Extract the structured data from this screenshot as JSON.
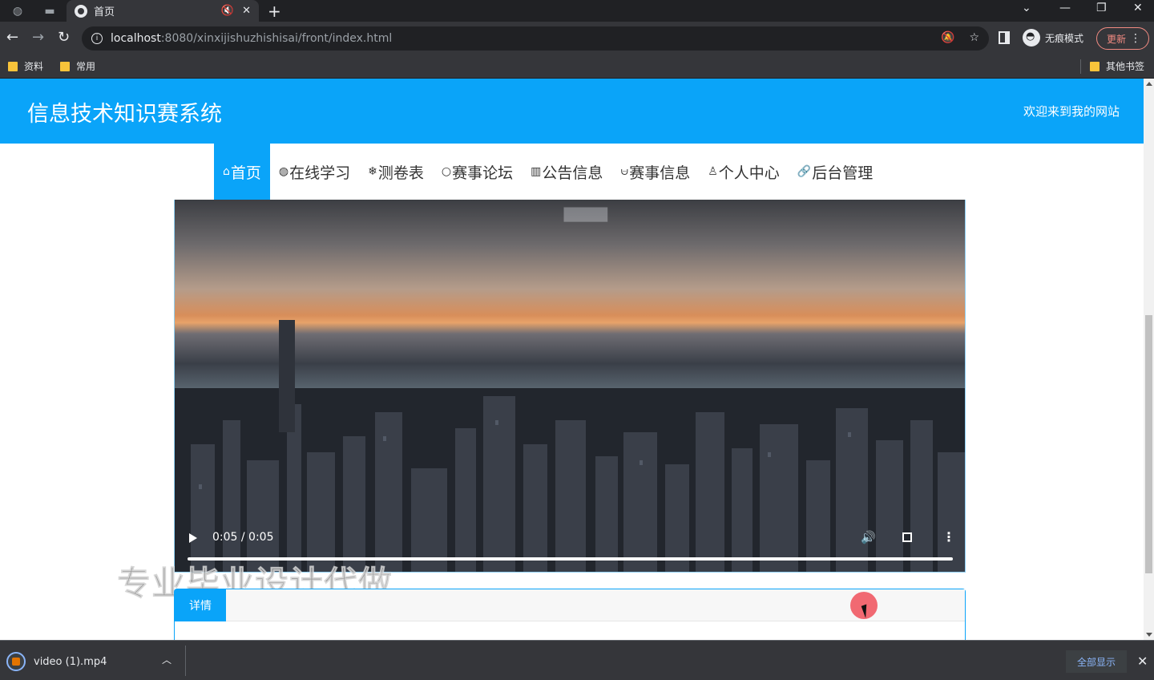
{
  "browser": {
    "tab_title": "首页",
    "url_host": "localhost",
    "url_rest": ":8080/xinxijishuzhishisai/front/index.html",
    "incognito_label": "无痕模式",
    "update_label": "更新",
    "bookmarks": [
      "资料",
      "常用"
    ],
    "other_bookmarks": "其他书签"
  },
  "site": {
    "title": "信息技术知识赛系统",
    "welcome": "欢迎来到我的网站",
    "nav": [
      {
        "icon": "⌂",
        "label": "首页",
        "active": true
      },
      {
        "icon": "◍",
        "label": "在线学习"
      },
      {
        "icon": "❄",
        "label": "测卷表"
      },
      {
        "icon": "○",
        "label": "赛事论坛"
      },
      {
        "icon": "▥",
        "label": "公告信息"
      },
      {
        "icon": "⩁",
        "label": "赛事信息"
      },
      {
        "icon": "♙",
        "label": "个人中心"
      },
      {
        "icon": "🔗",
        "label": "后台管理"
      }
    ]
  },
  "video": {
    "time": "0:05 / 0:05",
    "progress": 1.0
  },
  "overlay_text": "专业毕业设计代做",
  "details": {
    "tab_label": "详情"
  },
  "downloads": {
    "file_name": "video (1).mp4",
    "show_all": "全部显示"
  }
}
